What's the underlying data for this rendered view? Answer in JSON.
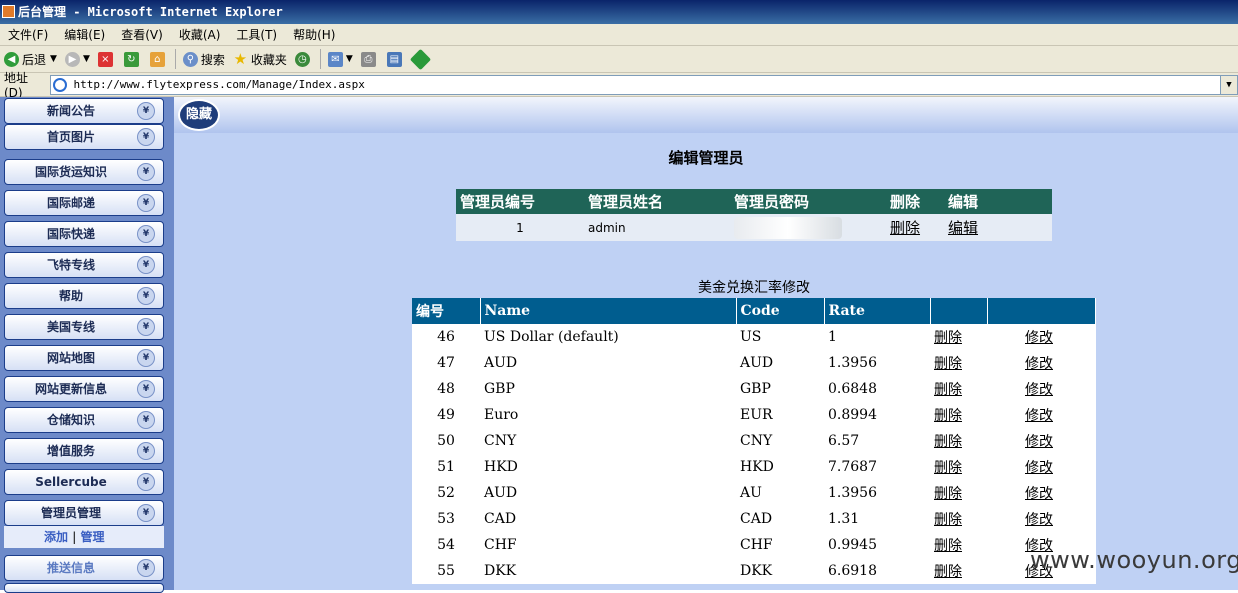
{
  "window": {
    "title": "后台管理 - Microsoft Internet Explorer"
  },
  "menu": [
    "文件(F)",
    "编辑(E)",
    "查看(V)",
    "收藏(A)",
    "工具(T)",
    "帮助(H)"
  ],
  "toolbar": {
    "back": "后退",
    "search": "搜索",
    "favorites": "收藏夹"
  },
  "address": {
    "label": "地址(D)",
    "url": "http://www.flytexpress.com/Manage/Index.aspx"
  },
  "sidebar": {
    "items": [
      "新闻公告",
      "首页图片",
      "国际货运知识",
      "国际邮递",
      "国际快递",
      "飞特专线",
      "帮助",
      "美国专线",
      "网站地图",
      "网站更新信息",
      "仓储知识",
      "增值服务",
      "Sellercube",
      "管理员管理",
      "推送信息"
    ],
    "chev": "¥",
    "sub": {
      "add": "添加",
      "sep": "|",
      "manage": "管理"
    }
  },
  "main": {
    "hide_label": "隐藏",
    "title": "编辑管理员"
  },
  "admin_table": {
    "headers": [
      "管理员编号",
      "管理员姓名",
      "管理员密码",
      "删除",
      "编辑"
    ],
    "rows": [
      {
        "id": "1",
        "name": "admin",
        "delete": "删除",
        "edit": "编辑"
      }
    ]
  },
  "rate_table": {
    "caption": "美金兑换汇率修改",
    "headers": [
      "编号",
      "Name",
      "Code",
      "Rate",
      "",
      ""
    ],
    "rows": [
      {
        "id": "46",
        "name": "US Dollar (default)",
        "code": "US",
        "rate": "1",
        "del": "删除",
        "edit": "修改"
      },
      {
        "id": "47",
        "name": "AUD",
        "code": "AUD",
        "rate": "1.3956",
        "del": "删除",
        "edit": "修改"
      },
      {
        "id": "48",
        "name": "GBP",
        "code": "GBP",
        "rate": "0.6848",
        "del": "删除",
        "edit": "修改"
      },
      {
        "id": "49",
        "name": "Euro",
        "code": "EUR",
        "rate": "0.8994",
        "del": "删除",
        "edit": "修改"
      },
      {
        "id": "50",
        "name": "CNY",
        "code": "CNY",
        "rate": "6.57",
        "del": "删除",
        "edit": "修改"
      },
      {
        "id": "51",
        "name": "HKD",
        "code": "HKD",
        "rate": "7.7687",
        "del": "删除",
        "edit": "修改"
      },
      {
        "id": "52",
        "name": "AUD",
        "code": "AU",
        "rate": "1.3956",
        "del": "删除",
        "edit": "修改"
      },
      {
        "id": "53",
        "name": "CAD",
        "code": "CAD",
        "rate": "1.31",
        "del": "删除",
        "edit": "修改"
      },
      {
        "id": "54",
        "name": "CHF",
        "code": "CHF",
        "rate": "0.9945",
        "del": "删除",
        "edit": "修改"
      },
      {
        "id": "55",
        "name": "DKK",
        "code": "DKK",
        "rate": "6.6918",
        "del": "删除",
        "edit": "修改"
      }
    ]
  },
  "watermark": "www.wooyun.org"
}
